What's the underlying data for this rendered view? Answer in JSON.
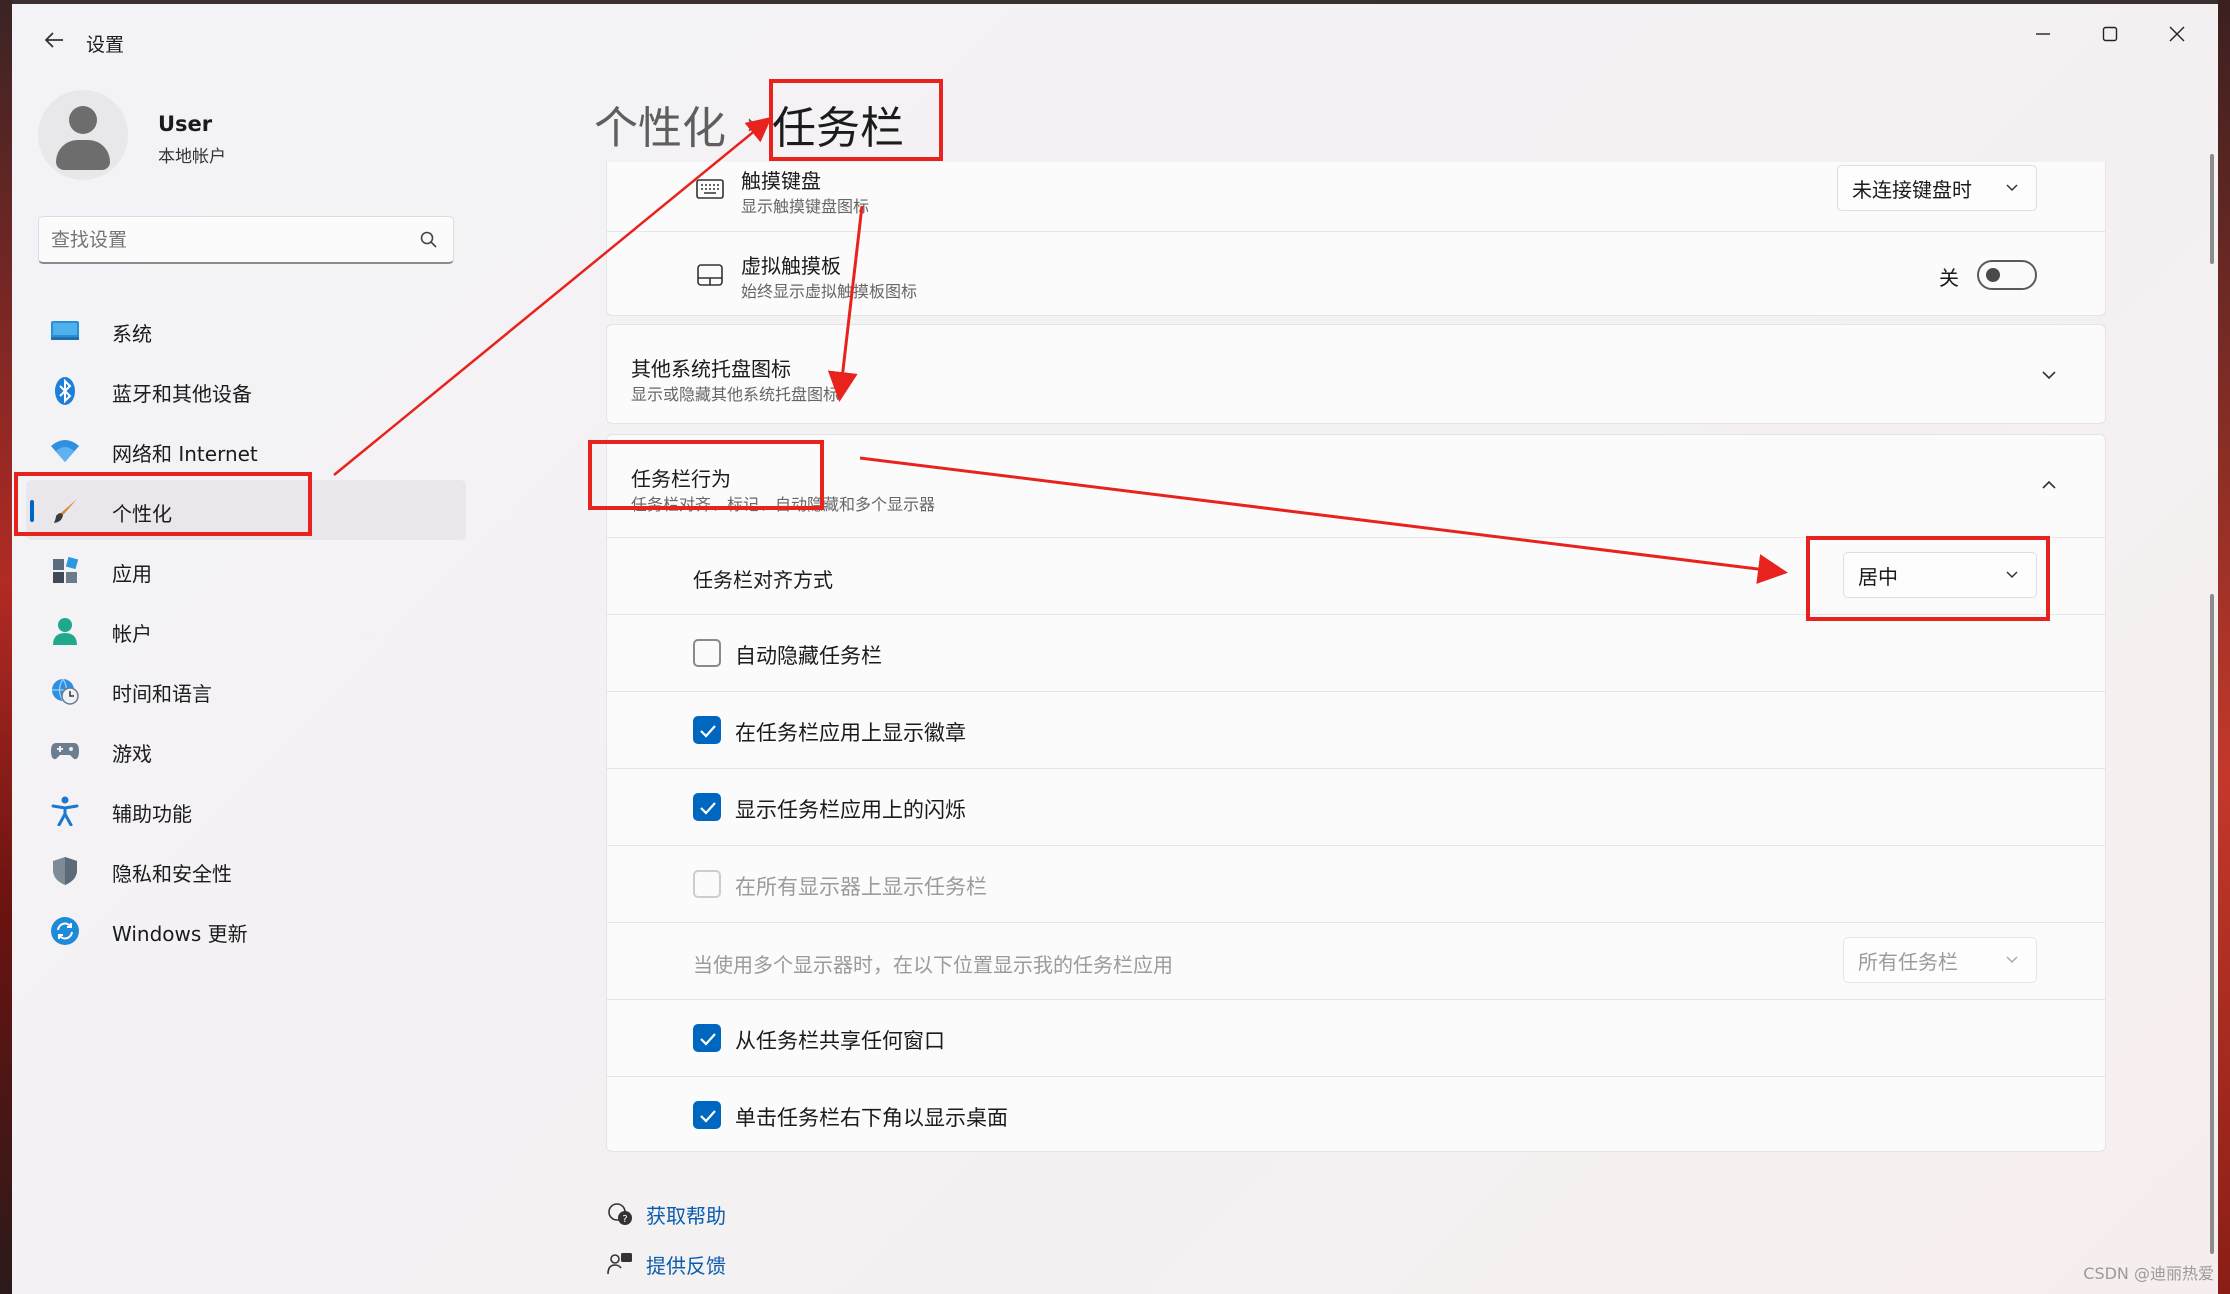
{
  "window": {
    "title": "设置",
    "controls": [
      "minimize",
      "maximize",
      "close"
    ]
  },
  "profile": {
    "name": "User",
    "account_type": "本地帐户"
  },
  "search": {
    "placeholder": "查找设置"
  },
  "sidebar": {
    "items": [
      {
        "label": "系统",
        "icon": "system-icon"
      },
      {
        "label": "蓝牙和其他设备",
        "icon": "bluetooth-icon"
      },
      {
        "label": "网络和 Internet",
        "icon": "wifi-icon"
      },
      {
        "label": "个性化",
        "icon": "paintbrush-icon",
        "active": true
      },
      {
        "label": "应用",
        "icon": "apps-icon"
      },
      {
        "label": "帐户",
        "icon": "account-icon"
      },
      {
        "label": "时间和语言",
        "icon": "globe-clock-icon"
      },
      {
        "label": "游戏",
        "icon": "gamepad-icon"
      },
      {
        "label": "辅助功能",
        "icon": "accessibility-icon"
      },
      {
        "label": "隐私和安全性",
        "icon": "shield-icon"
      },
      {
        "label": "Windows 更新",
        "icon": "update-icon"
      }
    ]
  },
  "breadcrumb": {
    "parent": "个性化",
    "separator": "›",
    "current": "任务栏"
  },
  "tray_icons": {
    "touch_keyboard": {
      "title": "触摸键盘",
      "subtitle": "显示触摸键盘图标",
      "value": "未连接键盘时"
    },
    "virtual_touchpad": {
      "title": "虚拟触摸板",
      "subtitle": "始终显示虚拟触摸板图标",
      "state_label": "关",
      "on": false
    }
  },
  "other_tray": {
    "title": "其他系统托盘图标",
    "subtitle": "显示或隐藏其他系统托盘图标",
    "expanded": false
  },
  "behaviors": {
    "title": "任务栏行为",
    "subtitle": "任务栏对齐、标记、自动隐藏和多个显示器",
    "expanded": true,
    "alignment": {
      "label": "任务栏对齐方式",
      "value": "居中"
    },
    "options": [
      {
        "label": "自动隐藏任务栏",
        "checked": false,
        "disabled": false
      },
      {
        "label": "在任务栏应用上显示徽章",
        "checked": true,
        "disabled": false
      },
      {
        "label": "显示任务栏应用上的闪烁",
        "checked": true,
        "disabled": false
      },
      {
        "label": "在所有显示器上显示任务栏",
        "checked": false,
        "disabled": true
      }
    ],
    "multi_display": {
      "label": "当使用多个显示器时，在以下位置显示我的任务栏应用",
      "value": "所有任务栏",
      "disabled": true
    },
    "options2": [
      {
        "label": "从任务栏共享任何窗口",
        "checked": true
      },
      {
        "label": "单击任务栏右下角以显示桌面",
        "checked": true
      }
    ]
  },
  "footer": {
    "help": "获取帮助",
    "feedback": "提供反馈"
  },
  "watermark": "CSDN @迪丽热爱",
  "colors": {
    "accent": "#0067c0",
    "annotation": "#e8231e"
  }
}
